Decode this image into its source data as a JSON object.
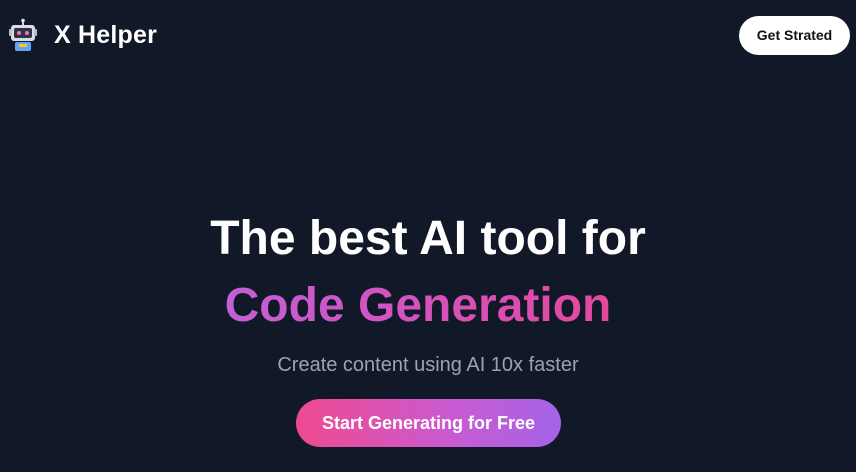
{
  "header": {
    "logo_icon": "robot-icon",
    "brand": "X Helper",
    "cta_label": "Get Strated"
  },
  "hero": {
    "headline_line1": "The best AI tool for",
    "headline_line2": "Code Generation",
    "subtitle": "Create content using AI 10x faster",
    "cta_label": "Start Generating for Free"
  },
  "colors": {
    "background": "#111827",
    "accent_gradient": [
      "#ef4a8f",
      "#c85bd3",
      "#a463e8"
    ],
    "headline_highlight": [
      "#c35fd6",
      "#e2499e"
    ],
    "subtitle": "#9ca3af"
  }
}
